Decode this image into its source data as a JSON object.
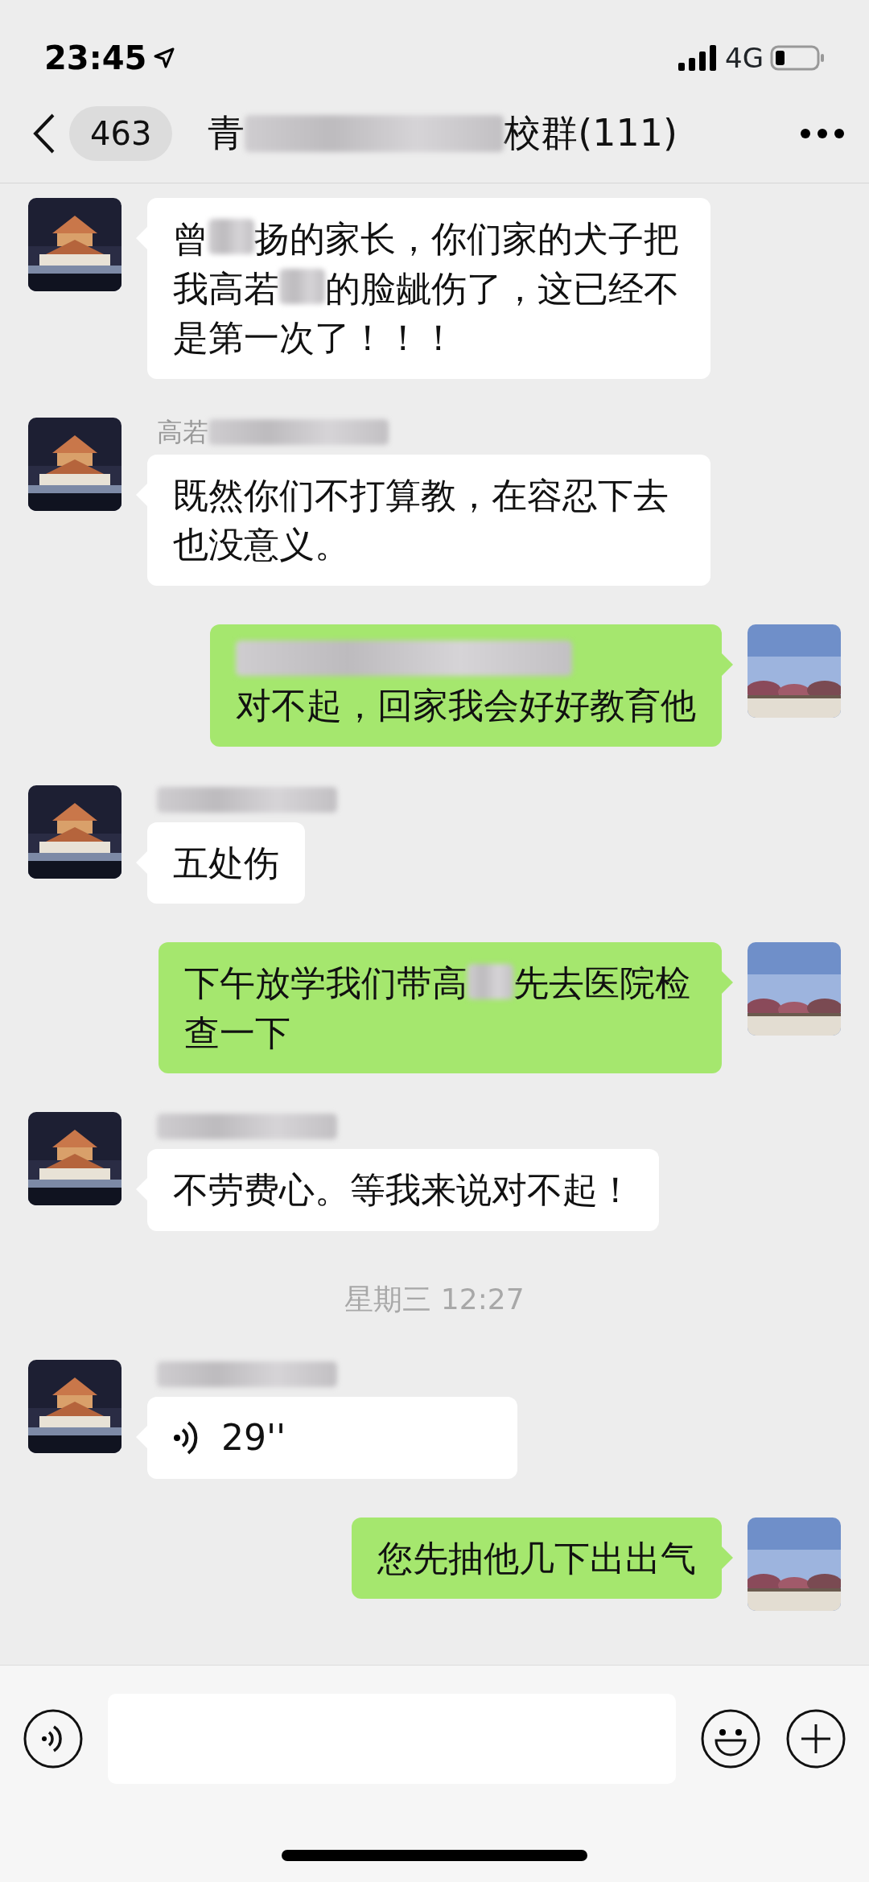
{
  "status_bar": {
    "time": "23:45",
    "network": "4G"
  },
  "header": {
    "back_count": "463",
    "title_parts": [
      {
        "kind": "text",
        "text": "青"
      },
      {
        "kind": "blur_long"
      },
      {
        "kind": "text",
        "text": "校群(111)"
      }
    ]
  },
  "messages": [
    {
      "kind": "text",
      "outgoing": false,
      "parts": [
        {
          "kind": "text",
          "text": "曾"
        },
        {
          "kind": "blur_short"
        },
        {
          "kind": "text",
          "text": "扬的家长，你们家的犬子把我高若"
        },
        {
          "kind": "blur_short"
        },
        {
          "kind": "text",
          "text": "的脸龇伤了，这已经不是第一次了！！！"
        }
      ]
    },
    {
      "kind": "text",
      "outgoing": false,
      "sender_parts": [
        {
          "kind": "text",
          "text": "高若"
        },
        {
          "kind": "blur_long"
        }
      ],
      "parts": [
        {
          "kind": "text",
          "text": "既然你们不打算教，在容忍下去也没意义。"
        }
      ]
    },
    {
      "kind": "text",
      "outgoing": true,
      "parts": [
        {
          "kind": "blur_line"
        },
        {
          "kind": "text",
          "text": "对不起，回家我会好好教育他"
        }
      ]
    },
    {
      "kind": "text",
      "outgoing": false,
      "sender_parts": [
        {
          "kind": "blur_long"
        }
      ],
      "parts": [
        {
          "kind": "text",
          "text": "五处伤"
        }
      ]
    },
    {
      "kind": "text",
      "outgoing": true,
      "parts": [
        {
          "kind": "text",
          "text": "下午放学我们带高"
        },
        {
          "kind": "blur_short"
        },
        {
          "kind": "text",
          "text": "先去医院检查一下"
        }
      ]
    },
    {
      "kind": "text",
      "outgoing": false,
      "sender_parts": [
        {
          "kind": "blur_long"
        }
      ],
      "parts": [
        {
          "kind": "text",
          "text": "不劳费心。等我来说对不起！"
        }
      ]
    },
    {
      "kind": "timestamp",
      "text": "星期三 12:27"
    },
    {
      "kind": "voice",
      "outgoing": false,
      "sender_parts": [
        {
          "kind": "blur_long"
        }
      ],
      "duration": "29''"
    },
    {
      "kind": "text",
      "outgoing": true,
      "parts": [
        {
          "kind": "text",
          "text": "您先抽他几下出出气"
        }
      ]
    }
  ]
}
